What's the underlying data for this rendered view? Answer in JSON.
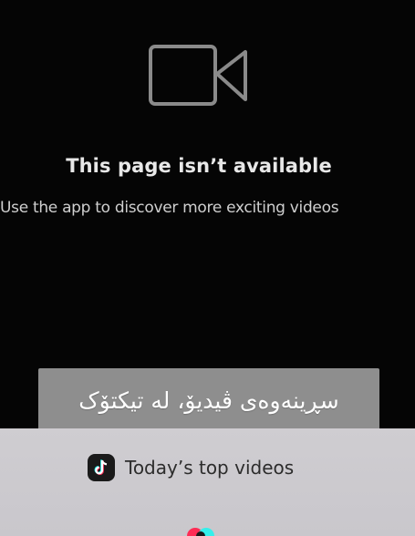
{
  "error": {
    "icon": "video-camera-icon",
    "title": "This page isn’t available",
    "subtitle": "Use the app to discover more exciting videos"
  },
  "caption": {
    "text": "سڕینەوەی ڤیدیۆ، لە تیکتۆک"
  },
  "bottom_sheet": {
    "icon": "tiktok-logo-icon",
    "label": "Today’s top videos"
  },
  "colors": {
    "background": "#050505",
    "caption_bg": "#8e8e8e",
    "sheet_bg": "#cfcdd1"
  }
}
